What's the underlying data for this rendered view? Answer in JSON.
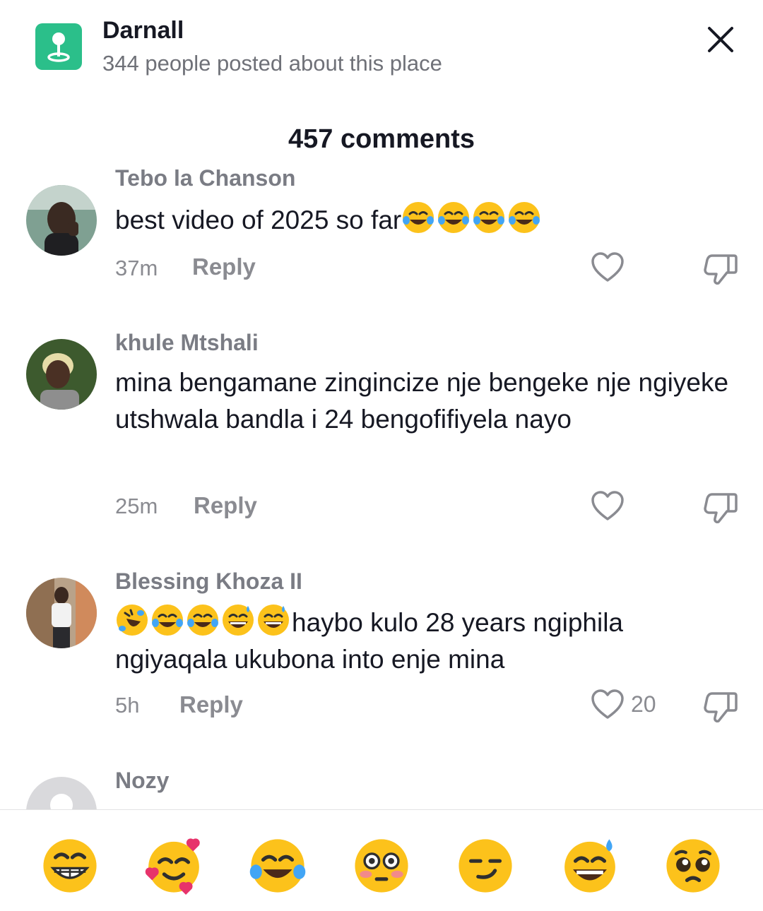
{
  "place": {
    "name": "Darnall",
    "subtitle": "344 people posted about this place",
    "icon": "location-pin-icon",
    "icon_color": "#2bbf8a"
  },
  "header": {
    "comments_count": "457 comments"
  },
  "comments": [
    {
      "username": "Tebo la Chanson",
      "text": "best video of 2025 so far",
      "emojis_after": [
        "face-with-tears-of-joy",
        "face-with-tears-of-joy",
        "face-with-tears-of-joy",
        "face-with-tears-of-joy"
      ],
      "time": "37m",
      "reply": "Reply",
      "likes": ""
    },
    {
      "username": "khule Mtshali",
      "text": "mina bengamane zingincize nje bengeke nje ngiyeke utshwala bandla i 24 bengofifiyela nayo",
      "time": "25m",
      "reply": "Reply",
      "likes": ""
    },
    {
      "username": "Blessing Khoza II",
      "emojis_before": [
        "rolling-on-floor-laughing",
        "face-with-tears-of-joy",
        "face-with-tears-of-joy",
        "grinning-face-with-sweat",
        "grinning-face-with-sweat"
      ],
      "text": "haybo kulo 28 years ngiphila ngiyaqala ukubona into enje mina",
      "time": "5h",
      "reply": "Reply",
      "likes": "20"
    },
    {
      "username": "Nozy"
    }
  ],
  "emoji_bar": [
    "beaming-face",
    "smiling-face-with-hearts",
    "face-with-tears-of-joy",
    "flushed-face",
    "smirking-face",
    "grinning-face-with-sweat",
    "pleading-face"
  ],
  "colors": {
    "text_primary": "#161823",
    "text_secondary": "#8a8b91",
    "emoji_yellow": "#fcc21b",
    "tear_blue": "#42a5f5"
  }
}
